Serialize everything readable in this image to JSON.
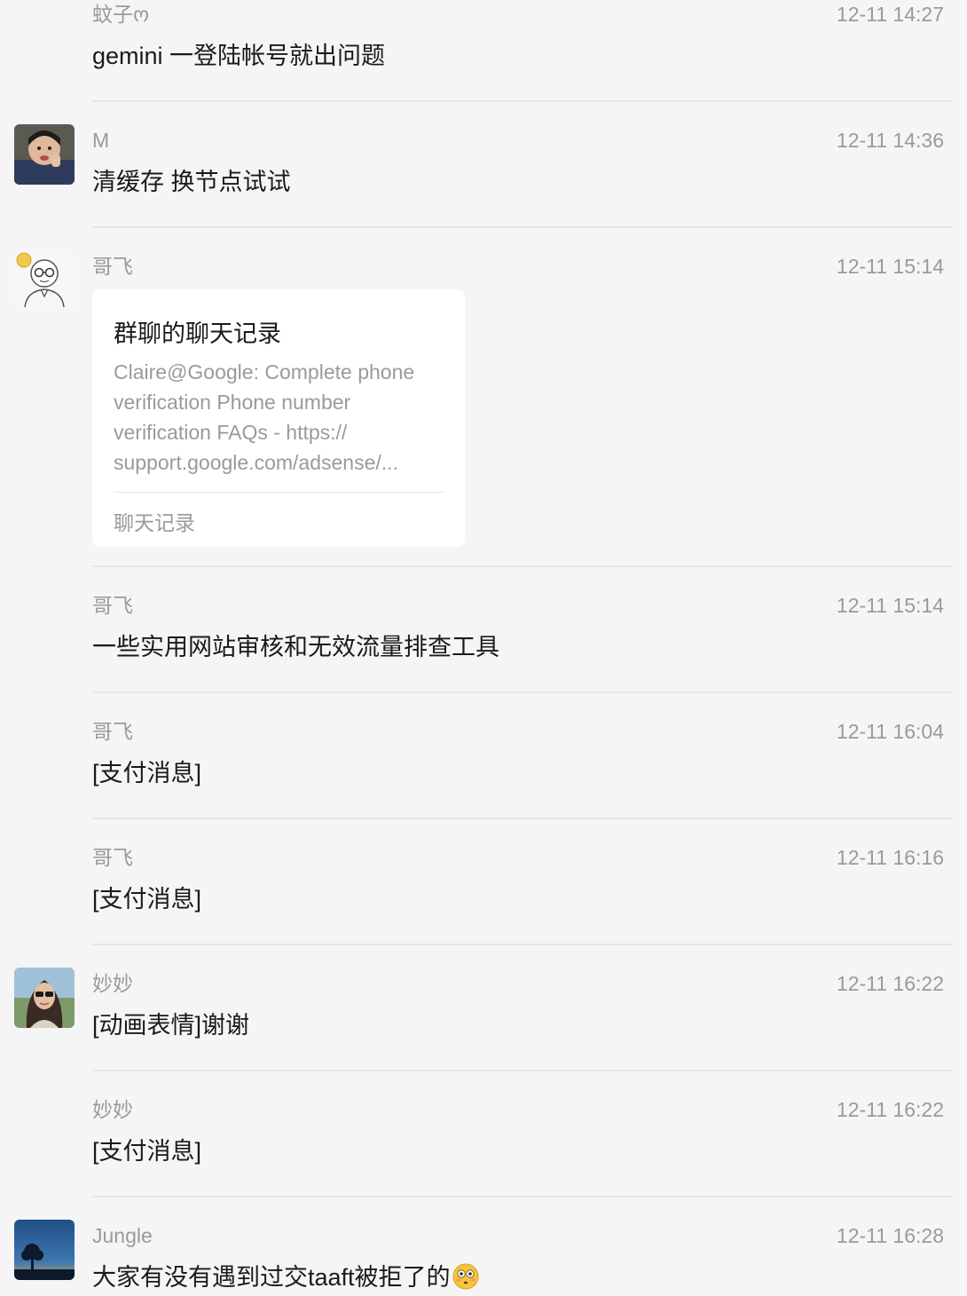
{
  "messages": [
    {
      "sender": "蚊子ო",
      "time": "12-11 14:27",
      "text": "gemini 一登陆帐号就出问题",
      "avatar": null
    },
    {
      "sender": "M",
      "time": "12-11 14:36",
      "text": "清缓存 换节点试试",
      "avatar": "child-photo-avatar"
    },
    {
      "sender": "哥飞",
      "time": "12-11 15:14",
      "avatar": "cartoon-man-glasses-avatar",
      "card": {
        "title": "群聊的聊天记录",
        "lines": [
          "Claire@Google: Complete phone",
          "verification Phone number",
          "verification FAQs - https://",
          "support.google.com/adsense/..."
        ],
        "footer": "聊天记录"
      }
    },
    {
      "sender": "哥飞",
      "time": "12-11 15:14",
      "text": "一些实用网站审核和无效流量排查工具"
    },
    {
      "sender": "哥飞",
      "time": "12-11 16:04",
      "text": "[支付消息]"
    },
    {
      "sender": "哥飞",
      "time": "12-11 16:16",
      "text": "[支付消息]"
    },
    {
      "sender": "妙妙",
      "time": "12-11 16:22",
      "text": "[动画表情]谢谢",
      "avatar": "woman-sunglasses-avatar"
    },
    {
      "sender": "妙妙",
      "time": "12-11 16:22",
      "text": "[支付消息]"
    },
    {
      "sender": "Jungle",
      "time": "12-11 16:28",
      "text": "大家有没有遇到过交taaft被拒了的",
      "avatar": "tree-sunset-avatar",
      "emoji": "flushed-face-emoji"
    }
  ],
  "colors": {
    "background": "#f5f5f5",
    "meta_text": "#9a9a9a",
    "message_text": "#1a1a1a",
    "divider": "#e6e6e6",
    "card_background": "#ffffff"
  }
}
